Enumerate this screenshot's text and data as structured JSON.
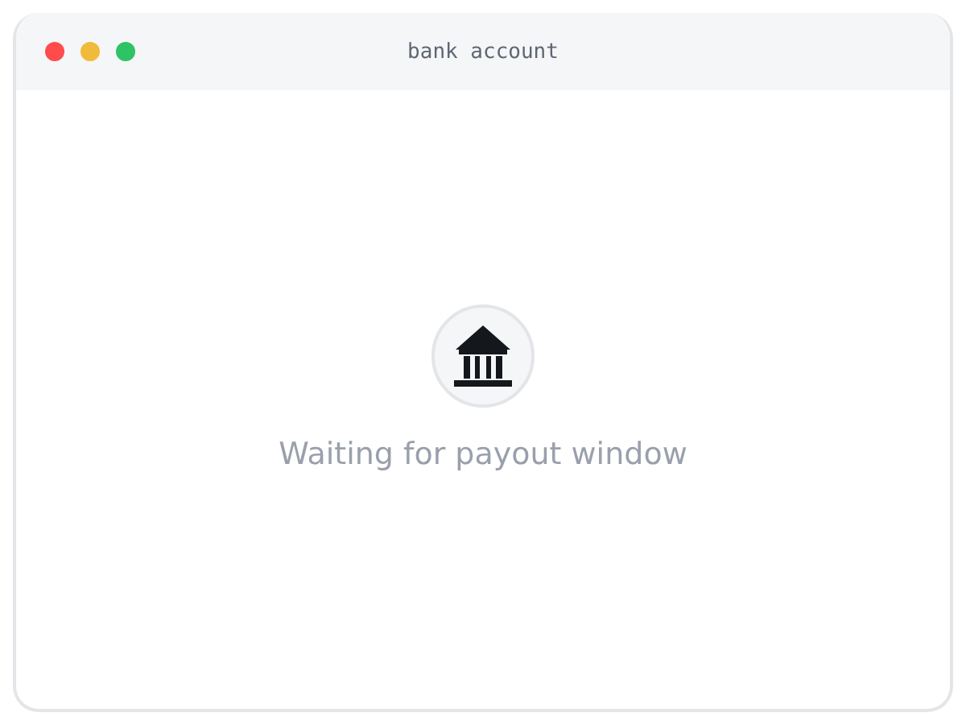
{
  "window": {
    "title": "bank account"
  },
  "empty_state": {
    "message": "Waiting for payout window"
  }
}
